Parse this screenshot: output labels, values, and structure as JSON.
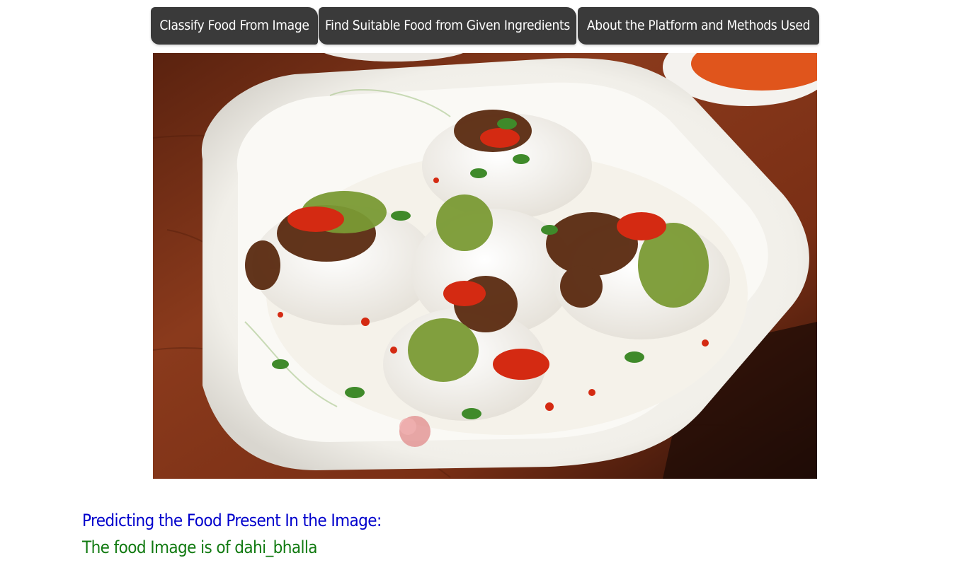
{
  "nav": {
    "buttons": [
      {
        "label": "Classify Food From Image"
      },
      {
        "label": "Find Suitable Food from Given Ingredients"
      },
      {
        "label": "About the Platform and Methods Used"
      }
    ]
  },
  "image": {
    "subject": "dahi bhalla on white plate"
  },
  "result": {
    "heading": "Predicting the Food Present In the Image:",
    "prediction": "The food Image is of dahi_bhalla"
  },
  "colors": {
    "nav_bg": "#3a3a3a",
    "nav_text": "#ffffff",
    "heading": "#0000cc",
    "prediction": "#117a11"
  }
}
